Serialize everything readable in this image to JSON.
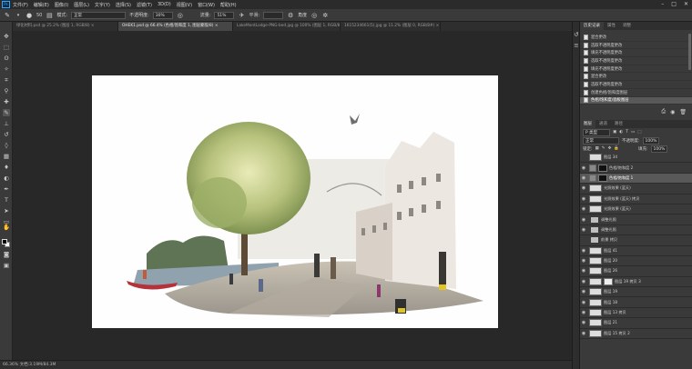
{
  "menu": {
    "logo": "Ps",
    "items": [
      "文件(F)",
      "编辑(E)",
      "图像(I)",
      "图层(L)",
      "文字(Y)",
      "选择(S)",
      "滤镜(T)",
      "3D(D)",
      "视图(V)",
      "窗口(W)",
      "帮助(H)"
    ],
    "window_controls": [
      "–",
      "□",
      "✕"
    ]
  },
  "options": {
    "brush_size": "50",
    "mode_label": "模式:",
    "mode_value": "正常",
    "opacity_label": "不透明度:",
    "opacity_value": "30%",
    "flow_label": "流量:",
    "flow_value": "51%",
    "smooth_label": "平滑:",
    "smooth_value": "",
    "extra_label": "角度"
  },
  "tabs": [
    {
      "label": "绿化材料.psd @ 25.2% (图层 1, RGB/8) ×",
      "active": false
    },
    {
      "label": "OHEK1.psd @ 66.4% (色相/饱和度 1, 图层蒙版/8) ×",
      "active": true
    },
    {
      "label": "LakeMontLodge-PNG-bed.jpg @ 100% (图层 1, RGB/8#) ×",
      "active": false
    },
    {
      "label": "1615234661(5).jpg @ 11.2% (图层 0, RGB/8#) ×",
      "active": false
    }
  ],
  "statusbar": {
    "text": "66.36%    文档:3.19M/84.3M"
  },
  "history_panel": {
    "tabs": [
      "历史记录",
      "属性",
      "调整"
    ],
    "items": [
      {
        "label": "混合更改",
        "active": false
      },
      {
        "label": "选取不透明度更改",
        "active": false
      },
      {
        "label": "填充不透明度更改",
        "active": false
      },
      {
        "label": "选取不透明度更改",
        "active": false
      },
      {
        "label": "填充不透明度更改",
        "active": false
      },
      {
        "label": "混合更改",
        "active": false
      },
      {
        "label": "选取不透明度更改",
        "active": false
      },
      {
        "label": "创建色相/饱和度图层",
        "active": false
      },
      {
        "label": "色相/饱和度/面板图层",
        "active": true
      }
    ]
  },
  "layers_panel": {
    "tabs": [
      "图层",
      "通道",
      "路径"
    ],
    "filter_label": "P 类型",
    "blend_mode": "正常",
    "opacity_label": "不透明度:",
    "opacity_value": "100%",
    "lock_label": "锁定:",
    "fill_label": "填充:",
    "fill_value": "100%",
    "layers": [
      {
        "name": "图层 34",
        "kind": "thumb",
        "visible": false,
        "selected": false
      },
      {
        "name": "色相/饱和度 2",
        "kind": "adjust",
        "visible": true,
        "selected": false
      },
      {
        "name": "色相/饱和度 1",
        "kind": "adjust",
        "visible": true,
        "selected": true
      },
      {
        "name": "光照效果 (蓝天)",
        "kind": "thumb",
        "visible": true,
        "selected": false
      },
      {
        "name": "光照效果 (蓝天) 拷贝",
        "kind": "thumb",
        "visible": true,
        "selected": false
      },
      {
        "name": "光照效果 (蓝天)",
        "kind": "thumb",
        "visible": true,
        "selected": false
      },
      {
        "name": "调整光照",
        "kind": "folder",
        "visible": true,
        "selected": false
      },
      {
        "name": "调整光照",
        "kind": "folder",
        "visible": true,
        "selected": false
      },
      {
        "name": "前景 拷贝",
        "kind": "folder",
        "visible": false,
        "selected": false
      },
      {
        "name": "图层 41",
        "kind": "thumb",
        "visible": true,
        "selected": false
      },
      {
        "name": "图层 20",
        "kind": "thumb",
        "visible": true,
        "selected": false
      },
      {
        "name": "图层 26",
        "kind": "thumb",
        "visible": true,
        "selected": false
      },
      {
        "name": "图层 19 拷贝 3",
        "kind": "masked",
        "visible": true,
        "selected": false
      },
      {
        "name": "图层 19",
        "kind": "thumb",
        "visible": true,
        "selected": false
      },
      {
        "name": "图层 18",
        "kind": "thumb",
        "visible": true,
        "selected": false
      },
      {
        "name": "图层 13 拷贝",
        "kind": "thumb",
        "visible": true,
        "selected": false
      },
      {
        "name": "图层 21",
        "kind": "thumb",
        "visible": true,
        "selected": false
      },
      {
        "name": "图层 15 拷贝 2",
        "kind": "thumb",
        "visible": true,
        "selected": false
      }
    ]
  }
}
